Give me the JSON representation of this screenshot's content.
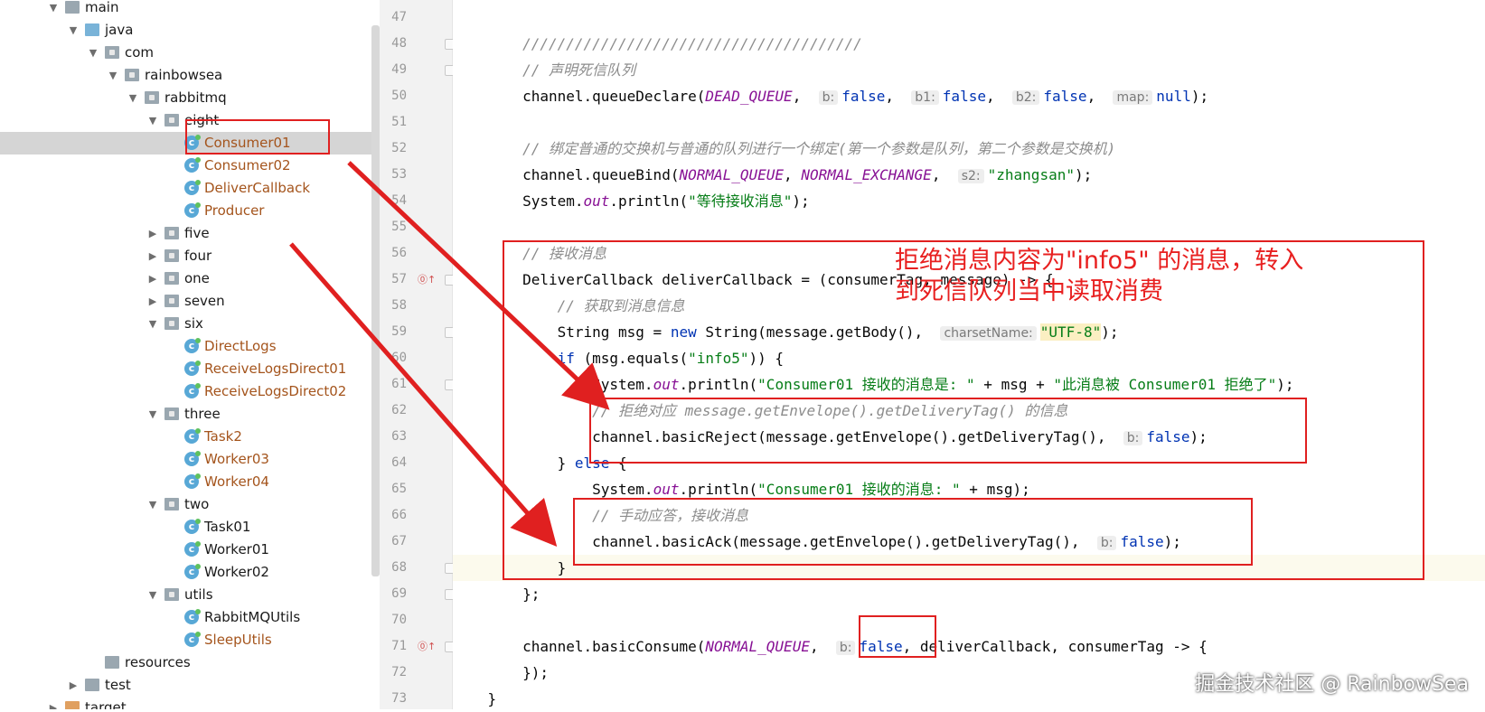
{
  "tree": {
    "items": [
      {
        "label": "main",
        "kind": "folder",
        "depth": 0,
        "expanded": true
      },
      {
        "label": "java",
        "kind": "srcfolder",
        "depth": 1,
        "expanded": true
      },
      {
        "label": "com",
        "kind": "package",
        "depth": 2,
        "expanded": true
      },
      {
        "label": "rainbowsea",
        "kind": "package",
        "depth": 3,
        "expanded": true
      },
      {
        "label": "rabbitmq",
        "kind": "package",
        "depth": 4,
        "expanded": true
      },
      {
        "label": "eight",
        "kind": "package",
        "depth": 5,
        "expanded": true
      },
      {
        "label": "Consumer01",
        "kind": "class",
        "depth": 6,
        "modified": true,
        "selected": true
      },
      {
        "label": "Consumer02",
        "kind": "class",
        "depth": 6,
        "modified": true
      },
      {
        "label": "DeliverCallback",
        "kind": "class",
        "depth": 6,
        "modified": true
      },
      {
        "label": "Producer",
        "kind": "class",
        "depth": 6,
        "modified": true
      },
      {
        "label": "five",
        "kind": "package",
        "depth": 5,
        "expanded": false
      },
      {
        "label": "four",
        "kind": "package",
        "depth": 5,
        "expanded": false
      },
      {
        "label": "one",
        "kind": "package",
        "depth": 5,
        "expanded": false
      },
      {
        "label": "seven",
        "kind": "package",
        "depth": 5,
        "expanded": false
      },
      {
        "label": "six",
        "kind": "package",
        "depth": 5,
        "expanded": true
      },
      {
        "label": "DirectLogs",
        "kind": "class",
        "depth": 6,
        "modified": true
      },
      {
        "label": "ReceiveLogsDirect01",
        "kind": "class",
        "depth": 6,
        "modified": true
      },
      {
        "label": "ReceiveLogsDirect02",
        "kind": "class",
        "depth": 6,
        "modified": true
      },
      {
        "label": "three",
        "kind": "package",
        "depth": 5,
        "expanded": true
      },
      {
        "label": "Task2",
        "kind": "class",
        "depth": 6,
        "modified": true
      },
      {
        "label": "Worker03",
        "kind": "class",
        "depth": 6,
        "modified": true
      },
      {
        "label": "Worker04",
        "kind": "class",
        "depth": 6,
        "modified": true
      },
      {
        "label": "two",
        "kind": "package",
        "depth": 5,
        "expanded": true
      },
      {
        "label": "Task01",
        "kind": "class",
        "depth": 6,
        "modified": false
      },
      {
        "label": "Worker01",
        "kind": "class",
        "depth": 6,
        "modified": false
      },
      {
        "label": "Worker02",
        "kind": "class",
        "depth": 6,
        "modified": false
      },
      {
        "label": "utils",
        "kind": "package",
        "depth": 5,
        "expanded": true
      },
      {
        "label": "RabbitMQUtils",
        "kind": "class",
        "depth": 6,
        "modified": false
      },
      {
        "label": "SleepUtils",
        "kind": "class",
        "depth": 6,
        "modified": true
      },
      {
        "label": "resources",
        "kind": "folder",
        "depth": 2,
        "expanded": null
      },
      {
        "label": "test",
        "kind": "folder",
        "depth": 1,
        "expanded": false
      },
      {
        "label": "target",
        "kind": "orangefolder",
        "depth": 0,
        "expanded": false
      }
    ]
  },
  "editor": {
    "lines": [
      {
        "n": "47",
        "segs": []
      },
      {
        "n": "48",
        "segs": [
          {
            "t": "        ///////////////////////////////////////",
            "c": "cm"
          }
        ]
      },
      {
        "n": "49",
        "segs": [
          {
            "t": "        // 声明死信队列",
            "c": "cm"
          }
        ]
      },
      {
        "n": "50",
        "segs": [
          {
            "t": "        channel.queueDeclare("
          },
          {
            "t": "DEAD_QUEUE",
            "c": "it"
          },
          {
            "t": ",  "
          },
          {
            "t": "b:",
            "c": "hint"
          },
          {
            "t": "false",
            "c": "kw"
          },
          {
            "t": ",  "
          },
          {
            "t": "b1:",
            "c": "hint"
          },
          {
            "t": "false",
            "c": "kw"
          },
          {
            "t": ",  "
          },
          {
            "t": "b2:",
            "c": "hint"
          },
          {
            "t": "false",
            "c": "kw"
          },
          {
            "t": ",  "
          },
          {
            "t": "map:",
            "c": "hint"
          },
          {
            "t": "null",
            "c": "kw"
          },
          {
            "t": ");"
          }
        ]
      },
      {
        "n": "51",
        "segs": []
      },
      {
        "n": "52",
        "segs": [
          {
            "t": "        // 绑定普通的交换机与普通的队列进行一个绑定(第一个参数是队列，第二个参数是交换机)",
            "c": "cm"
          }
        ]
      },
      {
        "n": "53",
        "segs": [
          {
            "t": "        channel.queueBind("
          },
          {
            "t": "NORMAL_QUEUE",
            "c": "it"
          },
          {
            "t": ", "
          },
          {
            "t": "NORMAL_EXCHANGE",
            "c": "it"
          },
          {
            "t": ",  "
          },
          {
            "t": "s2:",
            "c": "hint"
          },
          {
            "t": "\"zhangsan\"",
            "c": "str"
          },
          {
            "t": ");"
          }
        ]
      },
      {
        "n": "54",
        "segs": [
          {
            "t": "        System."
          },
          {
            "t": "out",
            "c": "it"
          },
          {
            "t": ".println("
          },
          {
            "t": "\"等待接收消息\"",
            "c": "str"
          },
          {
            "t": ");"
          }
        ]
      },
      {
        "n": "55",
        "segs": []
      },
      {
        "n": "56",
        "segs": [
          {
            "t": "        // 接收消息",
            "c": "cm"
          }
        ]
      },
      {
        "n": "57",
        "segs": [
          {
            "t": "        DeliverCallback deliverCallback = (consumerTag, message) -> {"
          }
        ]
      },
      {
        "n": "58",
        "segs": [
          {
            "t": "            // 获取到消息信息",
            "c": "cm"
          }
        ]
      },
      {
        "n": "59",
        "segs": [
          {
            "t": "            String msg = "
          },
          {
            "t": "new",
            "c": "kw"
          },
          {
            "t": " String(message.getBody(),  "
          },
          {
            "t": "charsetName:",
            "c": "hint"
          },
          {
            "t": "\"UTF-8\"",
            "c": "str hlstr"
          },
          {
            "t": ");"
          }
        ]
      },
      {
        "n": "60",
        "segs": [
          {
            "t": "            "
          },
          {
            "t": "if",
            "c": "kw"
          },
          {
            "t": " (msg.equals("
          },
          {
            "t": "\"info5\"",
            "c": "str"
          },
          {
            "t": ")) {"
          }
        ]
      },
      {
        "n": "61",
        "segs": [
          {
            "t": "                System."
          },
          {
            "t": "out",
            "c": "it"
          },
          {
            "t": ".println("
          },
          {
            "t": "\"Consumer01 接收的消息是: \"",
            "c": "str"
          },
          {
            "t": " + msg + "
          },
          {
            "t": "\"此消息被 Consumer01 拒绝了\"",
            "c": "str"
          },
          {
            "t": ");"
          }
        ]
      },
      {
        "n": "62",
        "segs": [
          {
            "t": "                // 拒绝对应 message.getEnvelope().getDeliveryTag() 的信息",
            "c": "cm"
          }
        ]
      },
      {
        "n": "63",
        "segs": [
          {
            "t": "                channel.basicReject(message.getEnvelope().getDeliveryTag(),  "
          },
          {
            "t": "b:",
            "c": "hint"
          },
          {
            "t": "false",
            "c": "kw"
          },
          {
            "t": ");"
          }
        ]
      },
      {
        "n": "64",
        "segs": [
          {
            "t": "            } "
          },
          {
            "t": "else",
            "c": "kw"
          },
          {
            "t": " {"
          }
        ]
      },
      {
        "n": "65",
        "segs": [
          {
            "t": "                System."
          },
          {
            "t": "out",
            "c": "it"
          },
          {
            "t": ".println("
          },
          {
            "t": "\"Consumer01 接收的消息: \"",
            "c": "str"
          },
          {
            "t": " + msg);"
          }
        ]
      },
      {
        "n": "66",
        "segs": [
          {
            "t": "                // 手动应答，接收消息",
            "c": "cm"
          }
        ]
      },
      {
        "n": "67",
        "segs": [
          {
            "t": "                channel.basicAck(message.getEnvelope().getDeliveryTag(),  "
          },
          {
            "t": "b:",
            "c": "hint"
          },
          {
            "t": "false",
            "c": "kw"
          },
          {
            "t": ");"
          }
        ]
      },
      {
        "n": "68",
        "segs": [
          {
            "t": "            }"
          }
        ],
        "current": true
      },
      {
        "n": "69",
        "segs": [
          {
            "t": "        };"
          }
        ]
      },
      {
        "n": "70",
        "segs": []
      },
      {
        "n": "71",
        "segs": [
          {
            "t": "        channel.basicConsume("
          },
          {
            "t": "NORMAL_QUEUE",
            "c": "it"
          },
          {
            "t": ",  "
          },
          {
            "t": "b:",
            "c": "hint"
          },
          {
            "t": "false",
            "c": "kw"
          },
          {
            "t": ", deliverCallback, consumerTag -> {"
          }
        ]
      },
      {
        "n": "72",
        "segs": [
          {
            "t": "        });"
          }
        ]
      },
      {
        "n": "73",
        "segs": [
          {
            "t": "    }"
          }
        ]
      }
    ]
  },
  "annotation": {
    "note_line1": "拒绝消息内容为\"info5\" 的消息，转入",
    "note_line2": "到死信队列当中读取消费",
    "color": "#e02020"
  },
  "watermark": "掘金技术社区 @ RainbowSea",
  "colors": {
    "comment": "#8c8c8c",
    "keyword": "#0033b3",
    "string": "#067d17",
    "field": "#871094",
    "modified_file": "#a4541c"
  }
}
